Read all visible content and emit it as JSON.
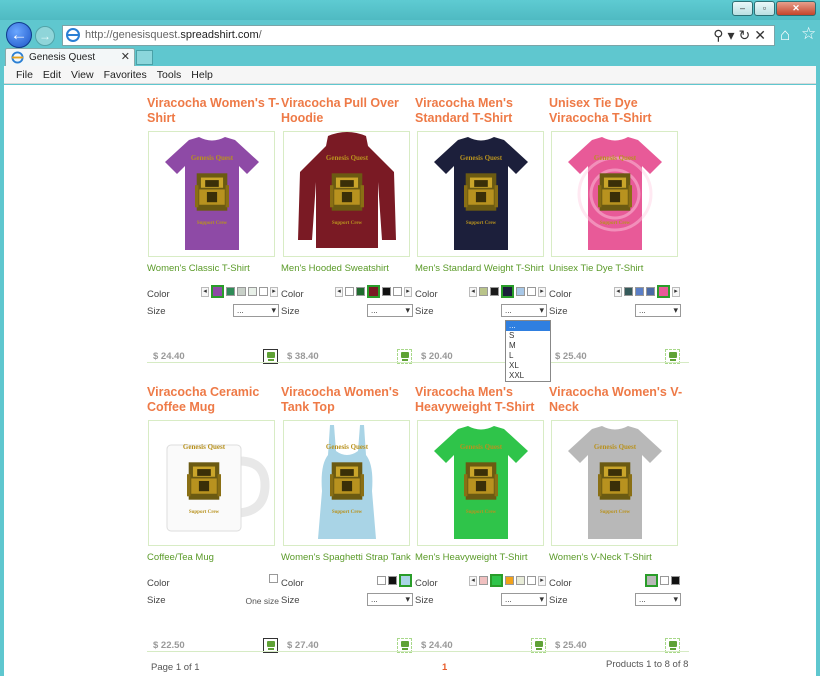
{
  "browser": {
    "url_prefix": "http://genesisquest.",
    "url_domain": "spreadshirt.com",
    "url_suffix": "/",
    "tab_title": "Genesis Quest",
    "menu": [
      "File",
      "Edit",
      "View",
      "Favorites",
      "Tools",
      "Help"
    ]
  },
  "products": [
    {
      "title": "Viracocha Women's T-Shirt",
      "type": "Women's Classic T-Shirt",
      "price": "$ 24.40",
      "color_label": "Color",
      "size_label": "Size",
      "size_value": "...",
      "garment": "tshirt",
      "garment_color": "#8e4aa6",
      "swatches": [
        "#8e4aa6",
        "#2e8b57",
        "#c8d0c8",
        "#e8f0e8",
        "#ffffff"
      ],
      "selected_swatch": 0
    },
    {
      "title": "Viracocha Pull Over Hoodie",
      "type": "Men's Hooded Sweatshirt",
      "price": "$ 38.40",
      "color_label": "Color",
      "size_label": "Size",
      "size_value": "...",
      "garment": "hoodie",
      "garment_color": "#7a1a24",
      "swatches": [
        "#ffffff",
        "#1f6b2e",
        "#7a1a24",
        "#111111",
        "#ffffff"
      ],
      "selected_swatch": 2
    },
    {
      "title": "Viracocha Men's Standard T-Shirt",
      "type": "Men's Standard Weight T-Shirt",
      "price": "$ 20.40",
      "color_label": "Color",
      "size_label": "Size",
      "size_value": "...",
      "garment": "tshirt",
      "garment_color": "#1c1f3b",
      "swatches": [
        "#b9c48a",
        "#1a1a1a",
        "#1c1f3b",
        "#a8c8e8",
        "#ffffff"
      ],
      "selected_swatch": 2
    },
    {
      "title": "Unisex Tie Dye Viracocha T-Shirt",
      "type": "Unisex Tie Dye T-Shirt",
      "price": "$ 25.40",
      "color_label": "Color",
      "size_label": "Size",
      "size_value": "...",
      "garment": "tiedye",
      "garment_color": "#e85a98",
      "swatches": [
        "#355a5a",
        "#5b7fc7",
        "#4b6aa5",
        "#e85a98"
      ],
      "selected_swatch": 3
    },
    {
      "title": "Viracocha Ceramic Coffee Mug",
      "type": "Coffee/Tea Mug",
      "price": "$ 22.50",
      "color_label": "Color",
      "size_label": "Size",
      "size_value": "One size",
      "garment": "mug",
      "garment_color": "#ffffff",
      "swatches": [
        "#ffffff"
      ],
      "selected_swatch": -1
    },
    {
      "title": "Viracocha Women's Tank Top",
      "type": "Women's Spaghetti Strap Tank",
      "price": "$ 27.40",
      "color_label": "Color",
      "size_label": "Size",
      "size_value": "...",
      "garment": "tank",
      "garment_color": "#a9d4e6",
      "swatches": [
        "#ffffff",
        "#111111",
        "#a9d4e6"
      ],
      "selected_swatch": 2
    },
    {
      "title": "Viracocha Men's Heavyweight T-Shirt",
      "type": "Men's Heavyweight T-Shirt",
      "price": "$ 24.40",
      "color_label": "Color",
      "size_label": "Size",
      "size_value": "...",
      "garment": "tshirt",
      "garment_color": "#2fc44a",
      "swatches": [
        "#f0c0c0",
        "#2fc44a",
        "#f2a21a",
        "#e8ecd8",
        "#ffffff"
      ],
      "selected_swatch": 1
    },
    {
      "title": "Viracocha Women's V-Neck",
      "type": "Women's V-Neck T-Shirt",
      "price": "$ 25.40",
      "color_label": "Color",
      "size_label": "Size",
      "size_value": "...",
      "garment": "tshirt",
      "garment_color": "#b8b8b8",
      "swatches": [
        "#b8b8b8",
        "#ffffff",
        "#111111"
      ],
      "selected_swatch": 0
    }
  ],
  "size_dropdown": {
    "options": [
      "...",
      "S",
      "M",
      "L",
      "XL",
      "XXL"
    ],
    "highlighted": 0
  },
  "design": {
    "top_text": "Genesis Quest",
    "bottom_text": "Support Crew"
  },
  "footer": {
    "page_info": "Page 1 of 1",
    "current_page": "1",
    "products_info": "Products 1 to 8 of 8"
  },
  "colors": {
    "accent": "#ee7a47",
    "link_green": "#5a9a28",
    "browser_chrome": "#5fc7cf"
  }
}
